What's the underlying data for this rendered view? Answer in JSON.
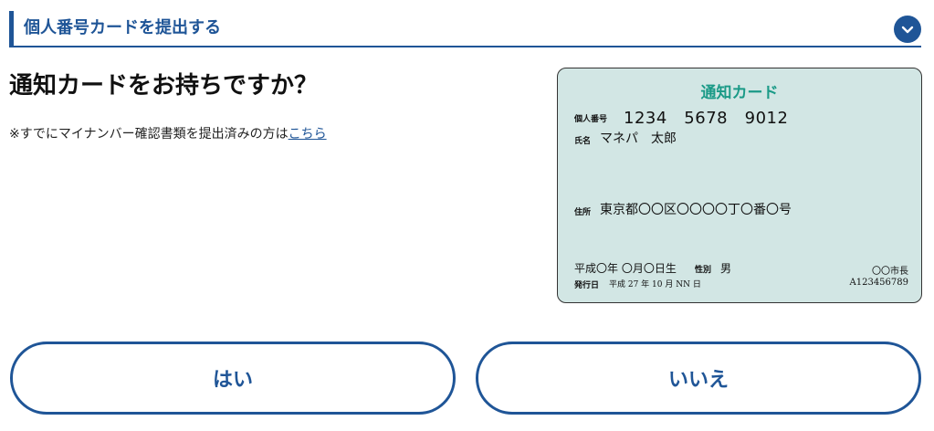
{
  "section": {
    "title": "個人番号カードを提出する"
  },
  "question": "通知カードをお持ちですか？",
  "note": {
    "text": "※すでにマイナンバー確認書類を提出済みの方は",
    "link": "こちら"
  },
  "card": {
    "title": "通知カード",
    "number_label": "個人番号",
    "number": "1234　5678　9012",
    "name_label": "氏名",
    "name": "マネパ　太郎",
    "address_label": "住所",
    "address": "東京都〇〇区〇〇〇〇丁〇番〇号",
    "dob": "平成〇年 〇月〇日生",
    "sex_label": "性別",
    "sex": "男",
    "issue_label": "発行日",
    "issue_date": "平成 27 年 10 月 NN 日",
    "mayor": "〇〇市長",
    "code": "A123456789"
  },
  "buttons": {
    "yes": "はい",
    "no": "いいえ"
  }
}
